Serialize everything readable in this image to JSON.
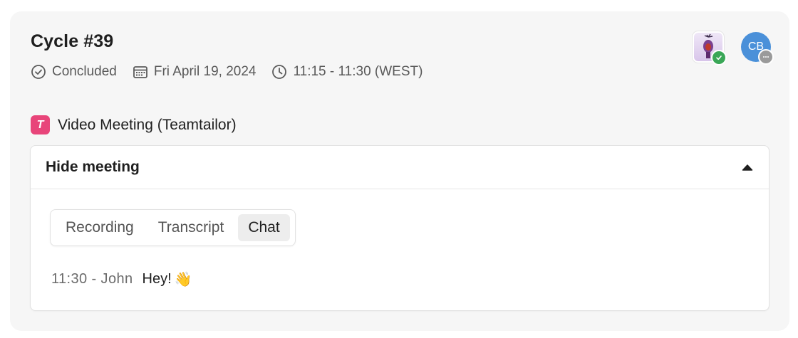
{
  "cycle": {
    "title": "Cycle #39",
    "status": "Concluded",
    "date": "Fri April 19, 2024",
    "time": "11:15 - 11:30 (WEST)"
  },
  "participants": {
    "second_initials": "CB"
  },
  "integration": {
    "logo_letter": "T",
    "label": "Video Meeting (Teamtailor)"
  },
  "meeting_panel": {
    "toggle_label": "Hide meeting",
    "tabs": [
      "Recording",
      "Transcript",
      "Chat"
    ],
    "active_tab": "Chat",
    "chat": [
      {
        "meta": "11:30 - John",
        "text": "Hey!",
        "emoji": "👋"
      }
    ]
  },
  "colors": {
    "card_bg": "#f6f6f6",
    "teamtailor_brand": "#e8457a",
    "avatar_blue": "#4a90d9",
    "status_ok_green": "#3aa757"
  },
  "icons": {
    "status": "check-circle-icon",
    "date": "calendar-icon",
    "time": "clock-icon",
    "collapse": "caret-up-icon"
  }
}
